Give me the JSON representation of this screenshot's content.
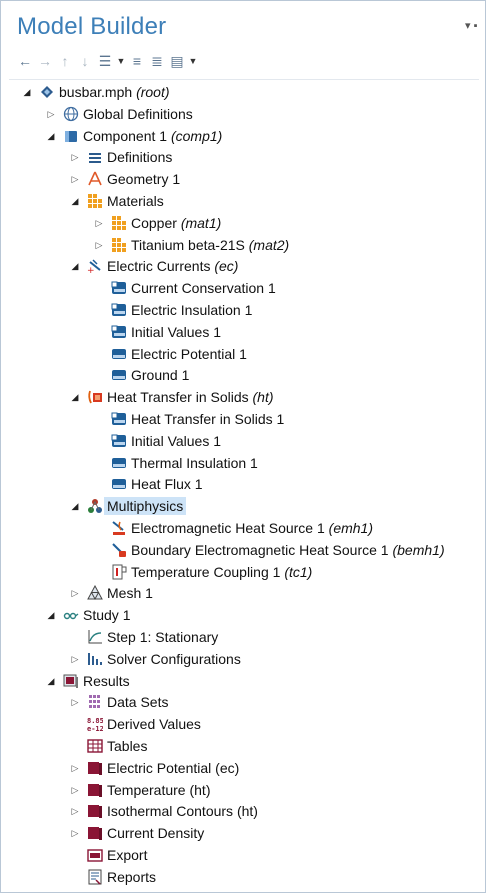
{
  "panel": {
    "title": "Model Builder",
    "pin_label": "▾ ⊕"
  },
  "toolbar": {
    "icons": [
      "arrow-left-icon",
      "arrow-right-icon",
      "arrow-up-icon",
      "arrow-down-icon",
      "show-icon",
      "expand-sections-icon",
      "collapse-sections-icon",
      "list-icon"
    ]
  },
  "tree": [
    {
      "name": "busbar.mph",
      "tag": "(root)",
      "state": "open",
      "icon": "model-root-icon"
    },
    {
      "name": "Global Definitions",
      "tag": "",
      "state": "closed",
      "icon": "globe-icon"
    },
    {
      "name": "Component 1",
      "tag": "(comp1)",
      "state": "open",
      "icon": "component-icon"
    },
    {
      "name": "Definitions",
      "tag": "",
      "state": "closed",
      "icon": "definitions-icon"
    },
    {
      "name": "Geometry 1",
      "tag": "",
      "state": "closed",
      "icon": "geometry-icon"
    },
    {
      "name": "Materials",
      "tag": "",
      "state": "open",
      "icon": "materials-icon"
    },
    {
      "name": "Copper",
      "tag": "(mat1)",
      "state": "closed",
      "icon": "material-icon"
    },
    {
      "name": "Titanium beta-21S",
      "tag": "(mat2)",
      "state": "closed",
      "icon": "material-icon"
    },
    {
      "name": "Electric Currents",
      "tag": "(ec)",
      "state": "open",
      "icon": "electric-currents-icon"
    },
    {
      "name": "Current Conservation 1",
      "tag": "",
      "state": "leaf",
      "icon": "physics-domain-icon"
    },
    {
      "name": "Electric Insulation 1",
      "tag": "",
      "state": "leaf",
      "icon": "physics-domain-icon"
    },
    {
      "name": "Initial Values 1",
      "tag": "",
      "state": "leaf",
      "icon": "physics-domain-icon"
    },
    {
      "name": "Electric Potential 1",
      "tag": "",
      "state": "leaf",
      "icon": "physics-boundary-icon"
    },
    {
      "name": "Ground 1",
      "tag": "",
      "state": "leaf",
      "icon": "physics-boundary-icon"
    },
    {
      "name": "Heat Transfer in Solids",
      "tag": "(ht)",
      "state": "open",
      "icon": "heat-transfer-icon"
    },
    {
      "name": "Heat Transfer in Solids 1",
      "tag": "",
      "state": "leaf",
      "icon": "physics-domain-icon"
    },
    {
      "name": "Initial Values 1",
      "tag": "",
      "state": "leaf",
      "icon": "physics-domain-icon"
    },
    {
      "name": "Thermal Insulation 1",
      "tag": "",
      "state": "leaf",
      "icon": "physics-boundary-icon"
    },
    {
      "name": "Heat Flux 1",
      "tag": "",
      "state": "leaf",
      "icon": "physics-boundary-icon"
    },
    {
      "name": "Multiphysics",
      "tag": "",
      "state": "open",
      "icon": "multiphysics-icon"
    },
    {
      "name": "Electromagnetic Heat Source 1",
      "tag": "(emh1)",
      "state": "leaf",
      "icon": "em-heat-source-icon"
    },
    {
      "name": "Boundary Electromagnetic Heat Source 1",
      "tag": "(bemh1)",
      "state": "leaf",
      "icon": "boundary-em-heat-icon"
    },
    {
      "name": "Temperature Coupling 1",
      "tag": "(tc1)",
      "state": "leaf",
      "icon": "temperature-coupling-icon"
    },
    {
      "name": "Mesh 1",
      "tag": "",
      "state": "closed",
      "icon": "mesh-icon"
    },
    {
      "name": "Study 1",
      "tag": "",
      "state": "open",
      "icon": "study-icon"
    },
    {
      "name": "Step 1: Stationary",
      "tag": "",
      "state": "leaf",
      "icon": "stationary-step-icon"
    },
    {
      "name": "Solver Configurations",
      "tag": "",
      "state": "closed",
      "icon": "solver-config-icon"
    },
    {
      "name": "Results",
      "tag": "",
      "state": "open",
      "icon": "results-icon"
    },
    {
      "name": "Data Sets",
      "tag": "",
      "state": "closed",
      "icon": "data-sets-icon"
    },
    {
      "name": "Derived Values",
      "tag": "",
      "state": "leaf",
      "icon": "derived-values-icon"
    },
    {
      "name": "Tables",
      "tag": "",
      "state": "leaf",
      "icon": "tables-icon"
    },
    {
      "name": "Electric Potential (ec)",
      "tag": "",
      "state": "closed",
      "icon": "plot-group-icon"
    },
    {
      "name": "Temperature (ht)",
      "tag": "",
      "state": "closed",
      "icon": "plot-group-icon"
    },
    {
      "name": "Isothermal Contours (ht)",
      "tag": "",
      "state": "closed",
      "icon": "plot-group-icon"
    },
    {
      "name": "Current Density",
      "tag": "",
      "state": "closed",
      "icon": "plot-group-icon"
    },
    {
      "name": "Export",
      "tag": "",
      "state": "leaf",
      "icon": "export-icon"
    },
    {
      "name": "Reports",
      "tag": "",
      "state": "leaf",
      "icon": "reports-icon"
    }
  ],
  "selected": "Multiphysics",
  "colors": {
    "title": "#3d7fb8",
    "selection": "#cde3f7",
    "physics_blue": "#1f5f99",
    "material_orange": "#f0a020",
    "results_maroon": "#8a1535"
  }
}
